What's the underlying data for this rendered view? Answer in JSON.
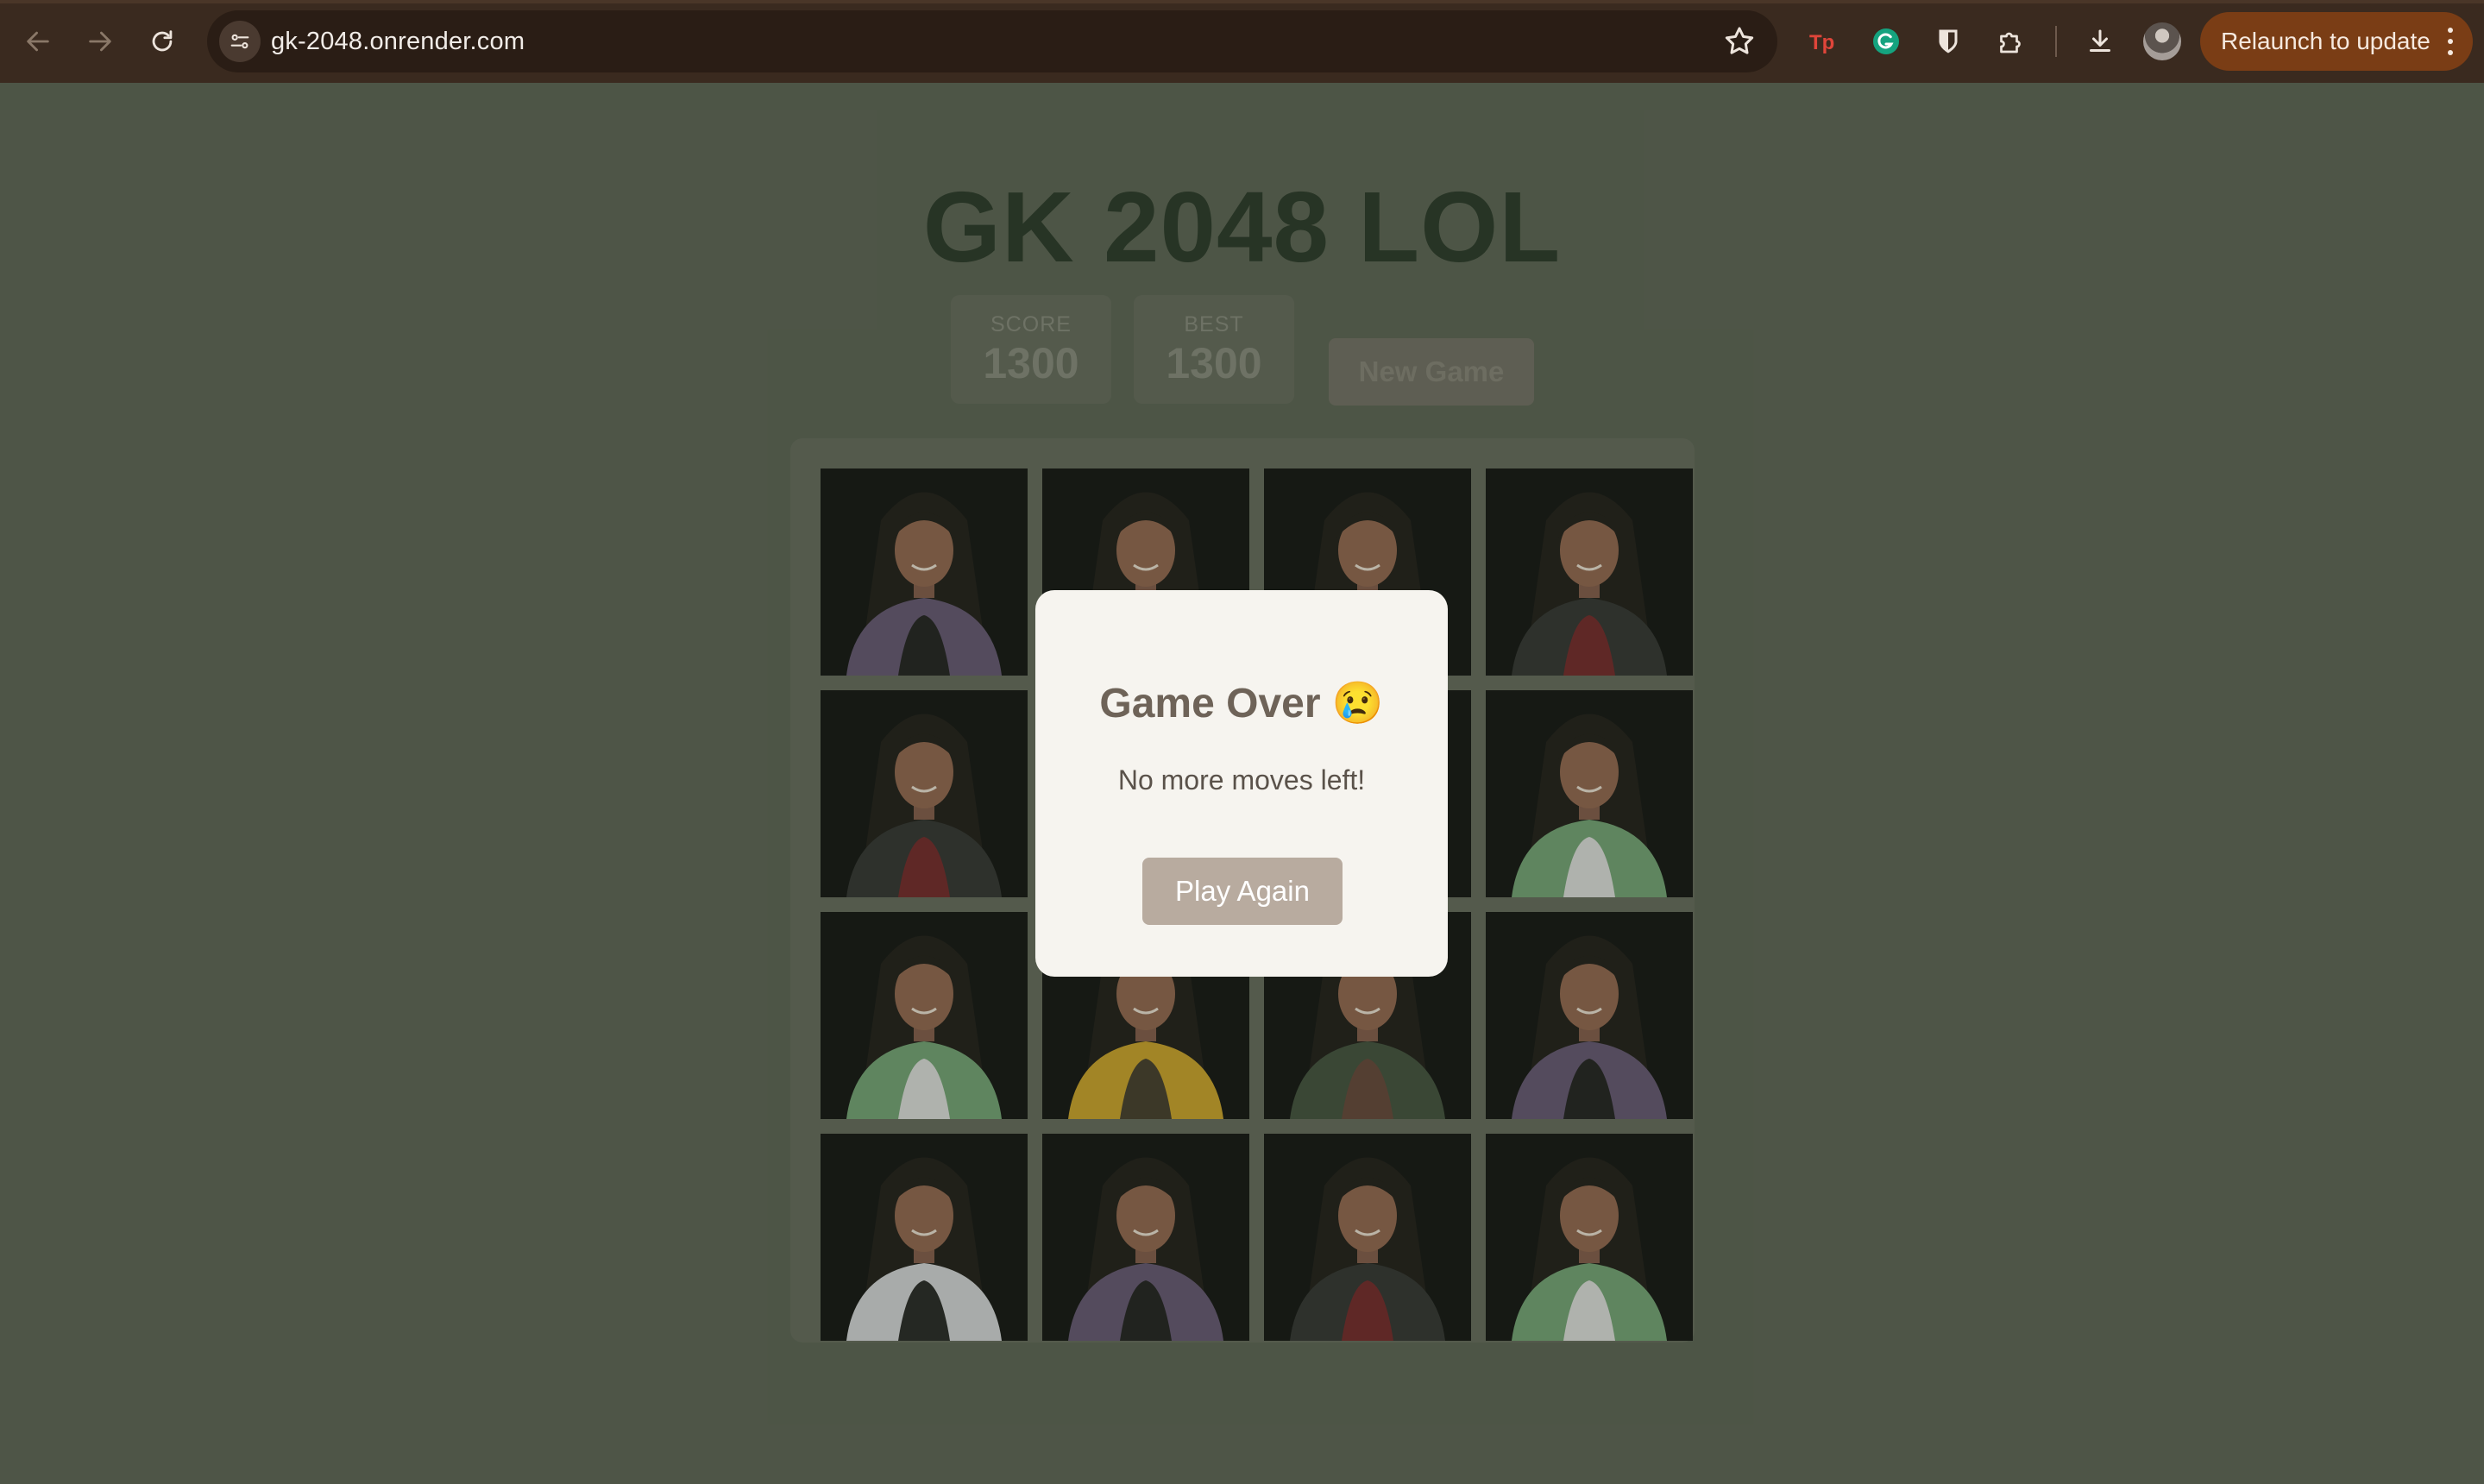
{
  "browser": {
    "url": "gk-2048.onrender.com",
    "relaunch_label": "Relaunch to update",
    "icons": [
      "back-icon",
      "forward-icon",
      "reload-icon",
      "site-info-icon",
      "bookmark-star-icon",
      "typingpal-extension-icon",
      "grammarly-extension-icon",
      "bitwarden-extension-icon",
      "extensions-puzzle-icon",
      "downloads-icon",
      "profile-avatar",
      "more-menu-icon"
    ],
    "colors": {
      "toolbar": "#3a2a1f",
      "omnibox": "#2a1d15",
      "relaunch": "#7a3d15"
    }
  },
  "game": {
    "title": "GK 2048 LOL",
    "score_label": "SCORE",
    "score_value": "1300",
    "best_label": "BEST",
    "best_value": "1300",
    "new_game_label": "New Game",
    "tiles": [
      [
        "photo-plaid-smile",
        "photo-leather-jacket",
        "photo-grey-top-pose",
        "photo-leather-jacket"
      ],
      [
        "photo-leather-jacket",
        "photo-leather-jacket",
        "photo-leather-jacket",
        "photo-green-cardigan"
      ],
      [
        "photo-green-cardigan",
        "photo-yellow-scarf",
        "photo-hands-on-chin",
        "photo-plaid-smile"
      ],
      [
        "photo-white-top-bag",
        "photo-plaid-smile",
        "photo-leather-jacket",
        "photo-green-cardigan"
      ]
    ],
    "colors": {
      "background": "#51584a",
      "board": "#5b5f53",
      "title": "#1d2a1c"
    }
  },
  "modal": {
    "title": "Game Over 😢",
    "message": "No more moves left!",
    "button_label": "Play Again",
    "colors": {
      "background": "#f6f4ef",
      "button": "#b8ab9f"
    }
  }
}
